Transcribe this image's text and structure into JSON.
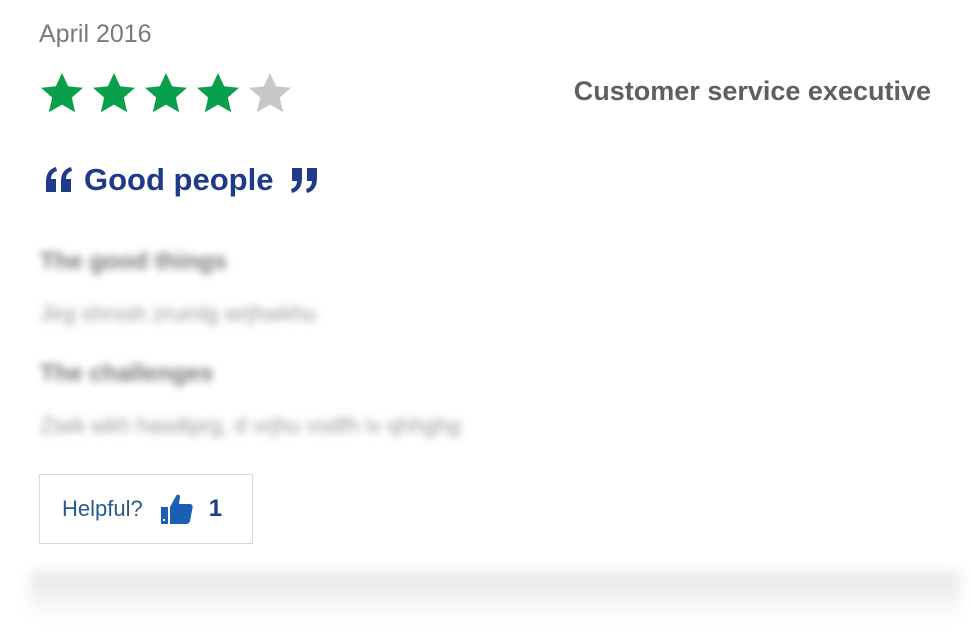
{
  "review": {
    "date": "April 2016",
    "rating": 4,
    "rating_max": 5,
    "job_title": "Customer service executive",
    "title": "Good people",
    "good_heading": "The good things",
    "good_text": "Jirg shrssh zrumlg wrjhwkhu",
    "challenges_heading": "The challenges",
    "challenges_text": "Ziwk wkh hasdtprg, d vrjhu vsdfh iv qhhghg"
  },
  "helpful": {
    "label": "Helpful?",
    "count": "1",
    "icon": "thumbs-up-icon"
  },
  "colors": {
    "star_filled": "#0aa04b",
    "star_empty": "#c8c8c8",
    "title_blue": "#1f3a8a",
    "thumb_blue": "#1a5fb4"
  }
}
